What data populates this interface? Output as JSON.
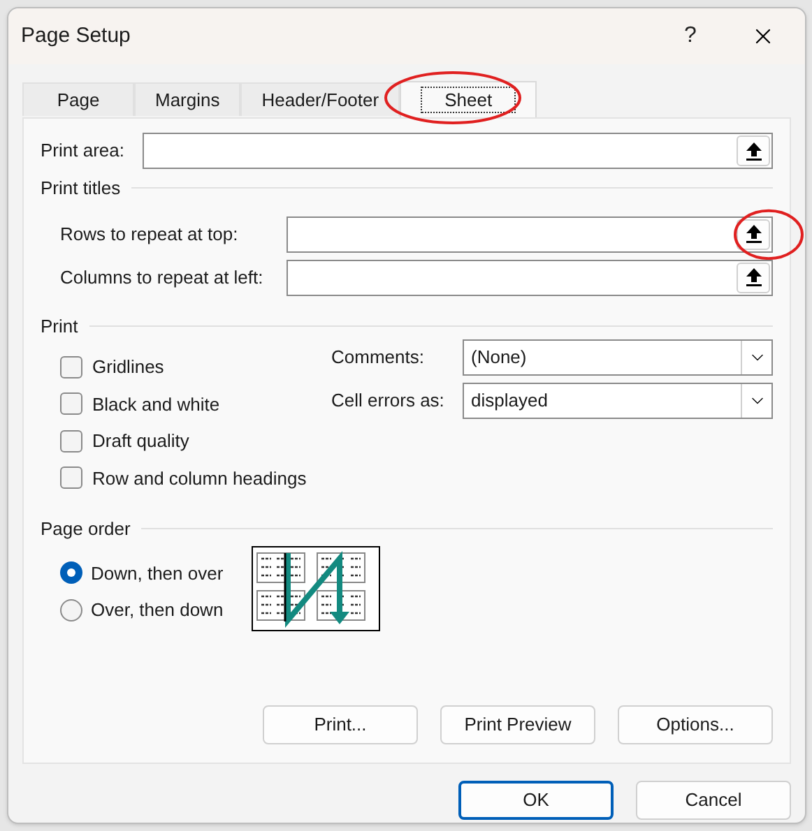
{
  "window": {
    "title": "Page Setup",
    "help": "?"
  },
  "tabs": [
    {
      "label": "Page",
      "selected": false,
      "highlighted": false
    },
    {
      "label": "Margins",
      "selected": false,
      "highlighted": false
    },
    {
      "label": "Header/Footer",
      "selected": false,
      "highlighted": false
    },
    {
      "label": "Sheet",
      "selected": true,
      "highlighted": true
    }
  ],
  "print_area": {
    "label": "Print area:",
    "highlighted": false
  },
  "print_titles": {
    "heading": "Print titles",
    "fields": [
      {
        "label": "Rows to repeat at top:",
        "highlighted": true
      },
      {
        "label": "Columns to repeat at left:",
        "highlighted": false
      }
    ]
  },
  "print": {
    "heading": "Print",
    "options": [
      {
        "label": "Gridlines",
        "checked": false
      },
      {
        "label": "Black and white",
        "checked": false
      },
      {
        "label": "Draft quality",
        "checked": false
      },
      {
        "label": "Row and column headings",
        "checked": false
      }
    ],
    "dropdowns": [
      {
        "label": "Comments:",
        "value": "(None)"
      },
      {
        "label": "Cell errors as:",
        "value": "displayed"
      }
    ]
  },
  "page_order": {
    "heading": "Page order",
    "options": [
      {
        "label": "Down, then over",
        "selected": true
      },
      {
        "label": "Over, then down",
        "selected": false
      }
    ]
  },
  "sheet_buttons": [
    "Print...",
    "Print Preview",
    "Options..."
  ],
  "dialog_buttons": [
    {
      "label": "OK",
      "default": true
    },
    {
      "label": "Cancel",
      "default": false
    }
  ]
}
